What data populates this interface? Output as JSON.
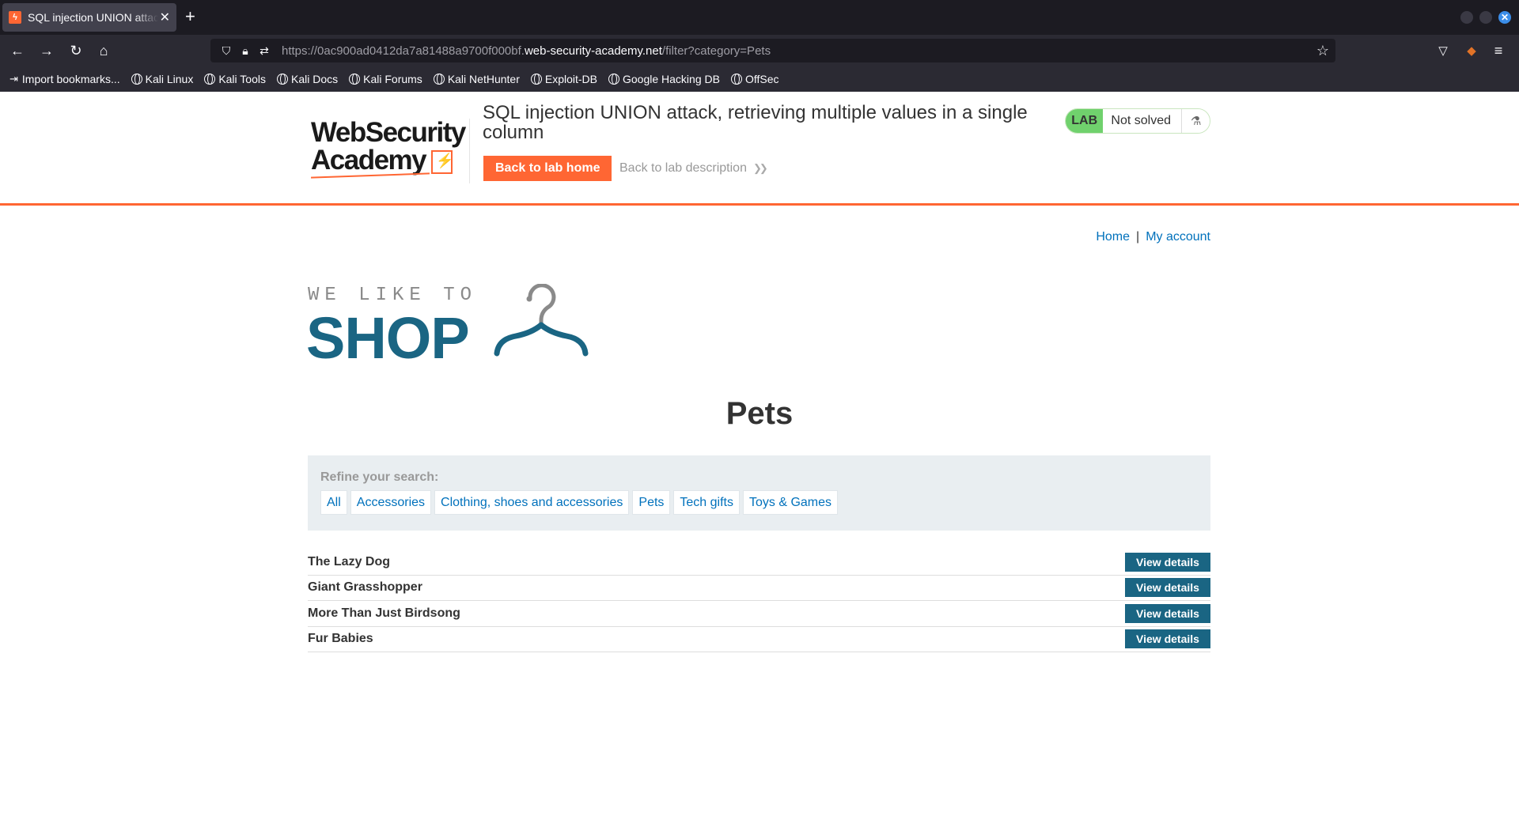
{
  "browser": {
    "tab_title": "SQL injection UNION attack",
    "tab_favicon": "ϟ",
    "url_prefix": "https://0ac900ad0412da7a81488a9700f000bf.",
    "url_domain": "web-security-academy.net",
    "url_path": "/filter?category=Pets",
    "bookmarks": [
      "Import bookmarks...",
      "Kali Linux",
      "Kali Tools",
      "Kali Docs",
      "Kali Forums",
      "Kali NetHunter",
      "Exploit-DB",
      "Google Hacking DB",
      "OffSec"
    ],
    "icons": [
      "back-icon",
      "forward-icon",
      "reload-icon",
      "home-icon",
      "shield-icon",
      "lock-icon",
      "permissions-icon",
      "bookmark-star-icon",
      "pocket-icon",
      "extension-icon",
      "menu-icon"
    ]
  },
  "lab": {
    "logo_line1": "WebSecurity",
    "logo_line2": "Academy",
    "title": "SQL injection UNION attack, retrieving multiple values in a single column",
    "back_home": "Back to lab home",
    "back_description": "Back to lab description",
    "status_badge": "LAB",
    "status_text": "Not solved",
    "accent_color": "#ff6633"
  },
  "shop": {
    "nav_home": "Home",
    "nav_sep": "|",
    "nav_account": "My account",
    "slogan": "WE LIKE TO",
    "logo_word": "SHOP",
    "category_title": "Pets",
    "refine_label": "Refine your search:",
    "filters": [
      "All",
      "Accessories",
      "Clothing, shoes and accessories",
      "Pets",
      "Tech gifts",
      "Toys & Games"
    ],
    "products": [
      {
        "name": "The Lazy Dog",
        "button": "View details"
      },
      {
        "name": "Giant Grasshopper",
        "button": "View details"
      },
      {
        "name": "More Than Just Birdsong",
        "button": "View details"
      },
      {
        "name": "Fur Babies",
        "button": "View details"
      }
    ],
    "brand_color": "#1a6583",
    "link_color": "#0071bc"
  }
}
